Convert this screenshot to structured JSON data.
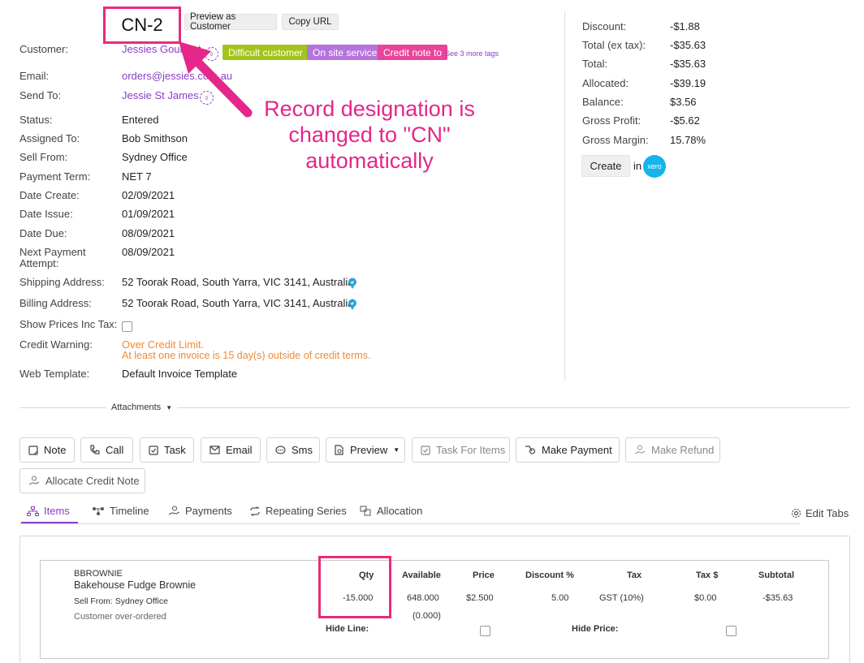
{
  "header": {
    "record_id": "CN-2",
    "preview_button": "Preview as Customer",
    "copy_url_button": "Copy URL"
  },
  "fields": {
    "customer_label": "Customer:",
    "customer_value": "Jessies Gourmet",
    "email_label": "Email:",
    "email_value": "orders@jessies.com.au",
    "sendto_label": "Send To:",
    "sendto_value": "Jessie St James",
    "status_label": "Status:",
    "status_value": "Entered",
    "assigned_label": "Assigned To:",
    "assigned_value": "Bob Smithson",
    "sellfrom_label": "Sell From:",
    "sellfrom_value": "Sydney Office",
    "payterm_label": "Payment Term:",
    "payterm_value": "NET 7",
    "datecreate_label": "Date Create:",
    "datecreate_value": "02/09/2021",
    "dateissue_label": "Date Issue:",
    "dateissue_value": "01/09/2021",
    "datedue_label": "Date Due:",
    "datedue_value": "08/09/2021",
    "nextpay_label_1": "Next Payment",
    "nextpay_label_2": "Attempt:",
    "nextpay_value": "08/09/2021",
    "shipping_label": "Shipping Address:",
    "shipping_value": "52 Toorak Road, South Yarra, VIC 3141, Australia",
    "billing_label": "Billing Address:",
    "billing_value": "52 Toorak Road, South Yarra, VIC 3141, Australia",
    "showprices_label": "Show Prices Inc Tax:",
    "creditwarn_label": "Credit Warning:",
    "creditwarn_line1": "Over Credit Limit.",
    "creditwarn_line2": "At least one invoice is 15 day(s) outside of credit terms.",
    "webtemplate_label": "Web Template:",
    "webtemplate_value": "Default Invoice Template"
  },
  "tags": {
    "items": [
      {
        "label": "Difficult customer",
        "color": "#a3c31d"
      },
      {
        "label": "On site service",
        "color": "#b574dc"
      },
      {
        "label": "Credit note to",
        "color": "#e8449a"
      }
    ],
    "more": "See 3 more tags"
  },
  "annotation": {
    "line1": "Record designation is",
    "line2": "changed to \"CN\"",
    "line3": "automatically",
    "color": "#e5268a"
  },
  "summary": {
    "discount_label": "Discount:",
    "discount_value": "-$1.88",
    "totalex_label": "Total (ex tax):",
    "totalex_value": "-$35.63",
    "total_label": "Total:",
    "total_value": "-$35.63",
    "allocated_label": "Allocated:",
    "allocated_value": "-$39.19",
    "balance_label": "Balance:",
    "balance_value": "$3.56",
    "grossprofit_label": "Gross Profit:",
    "grossprofit_value": "-$5.62",
    "grossmargin_label": "Gross Margin:",
    "grossmargin_value": "15.78%",
    "create_button": "Create",
    "in_text": "in",
    "xero_logo": "xero"
  },
  "attachments": {
    "label": "Attachments"
  },
  "actions": {
    "note": "Note",
    "call": "Call",
    "task": "Task",
    "email": "Email",
    "sms": "Sms",
    "preview": "Preview",
    "task_for_items": "Task For Items",
    "make_payment": "Make Payment",
    "make_refund": "Make Refund",
    "allocate_credit_note": "Allocate Credit Note"
  },
  "tabs": {
    "items": "Items",
    "timeline": "Timeline",
    "payments": "Payments",
    "repeating": "Repeating Series",
    "allocation": "Allocation",
    "edit_tabs": "Edit Tabs"
  },
  "line_items": {
    "headers": {
      "qty": "Qty",
      "available": "Available",
      "price": "Price",
      "discount": "Discount %",
      "tax": "Tax",
      "tax_amount": "Tax $",
      "subtotal": "Subtotal"
    },
    "row": {
      "sku": "BBROWNIE",
      "name": "Bakehouse Fudge Brownie",
      "sell_from_label": "Sell From:",
      "sell_from_value": "Sydney Office",
      "note": "Customer over-ordered",
      "qty": "-15.000",
      "available": "648.000",
      "available_sub": "(0.000)",
      "price": "$2.500",
      "discount": "5.00",
      "tax": "GST (10%)",
      "tax_amount": "$0.00",
      "subtotal": "-$35.63",
      "hide_line_label": "Hide Line:",
      "hide_price_label": "Hide Price:"
    }
  }
}
